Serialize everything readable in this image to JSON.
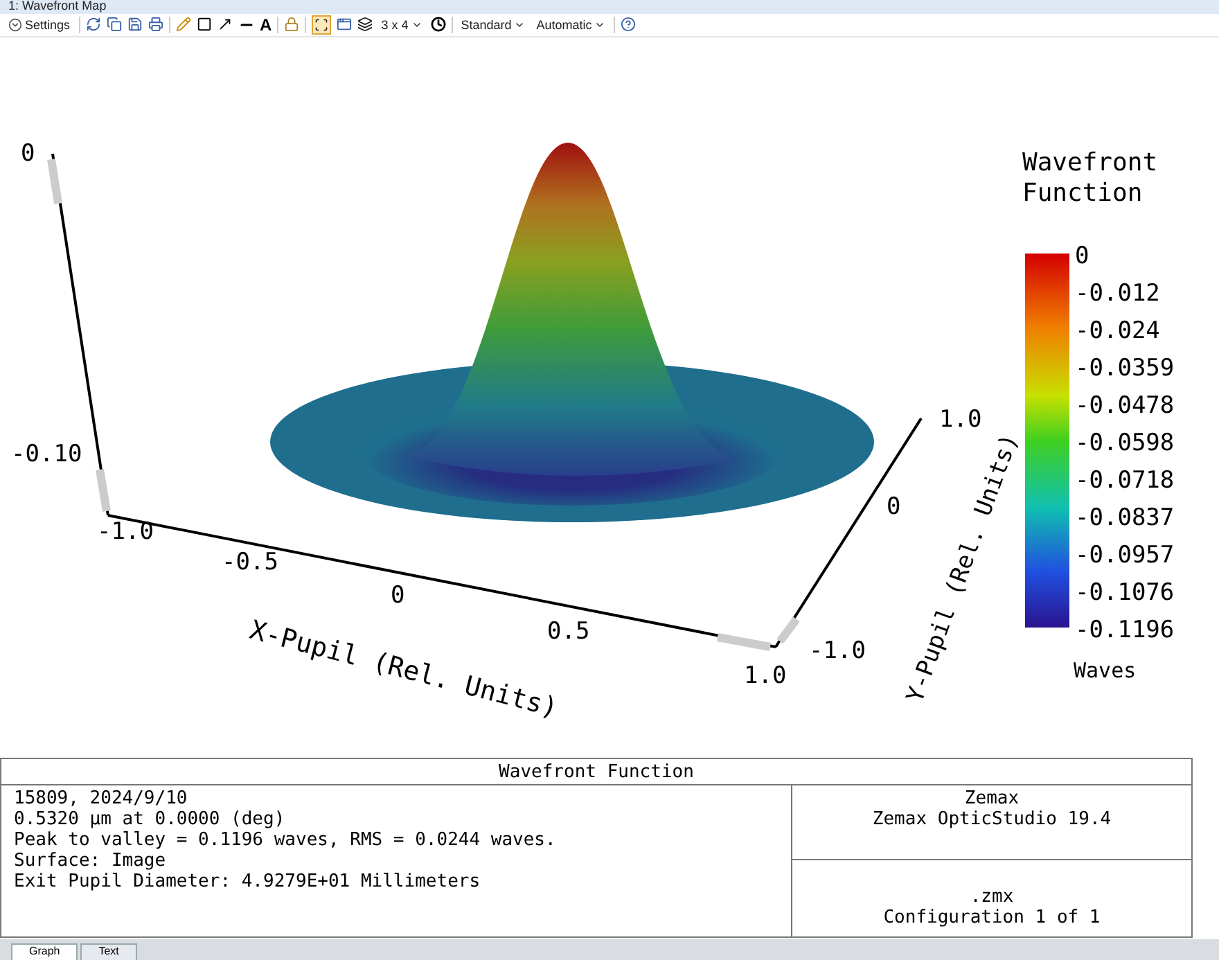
{
  "window": {
    "title": "1: Wavefront Map"
  },
  "toolbar": {
    "settings_label": "Settings",
    "text_tool": "A",
    "layout_button_on": true,
    "grid_size": "3 x 4",
    "dropdowns": [
      "Standard",
      "Automatic"
    ]
  },
  "plot": {
    "z_ticks": [
      "0",
      "-0.10"
    ],
    "x_ticks": [
      "-1.0",
      "-0.5",
      "0",
      "0.5",
      "1.0"
    ],
    "x_label": "X-Pupil (Rel. Units)",
    "y_ticks": [
      "1.0",
      "0",
      "-1.0"
    ],
    "y_label": "Y-Pupil (Rel. Units)",
    "legend": {
      "title_lines": [
        "Wavefront",
        "Function"
      ],
      "ticks": [
        "0",
        "-0.012",
        "-0.024",
        "-0.0359",
        "-0.0478",
        "-0.0598",
        "-0.0718",
        "-0.0837",
        "-0.0957",
        "-0.1076",
        "-0.1196"
      ],
      "unit": "Waves"
    }
  },
  "info_table": {
    "title": "Wavefront Function",
    "lines": [
      "15809, 2024/9/10",
      "0.5320 µm at 0.0000 (deg)",
      "Peak to valley = 0.1196 waves, RMS = 0.0244 waves.",
      "Surface: Image",
      "Exit Pupil Diameter: 4.9279E+01 Millimeters"
    ],
    "company": [
      "Zemax",
      "Zemax OpticStudio 19.4"
    ],
    "file": [
      ".zmx",
      "Configuration 1 of 1"
    ]
  },
  "tabs": [
    {
      "label": "Graph",
      "selected": true
    },
    {
      "label": "Text",
      "selected": false
    }
  ]
}
